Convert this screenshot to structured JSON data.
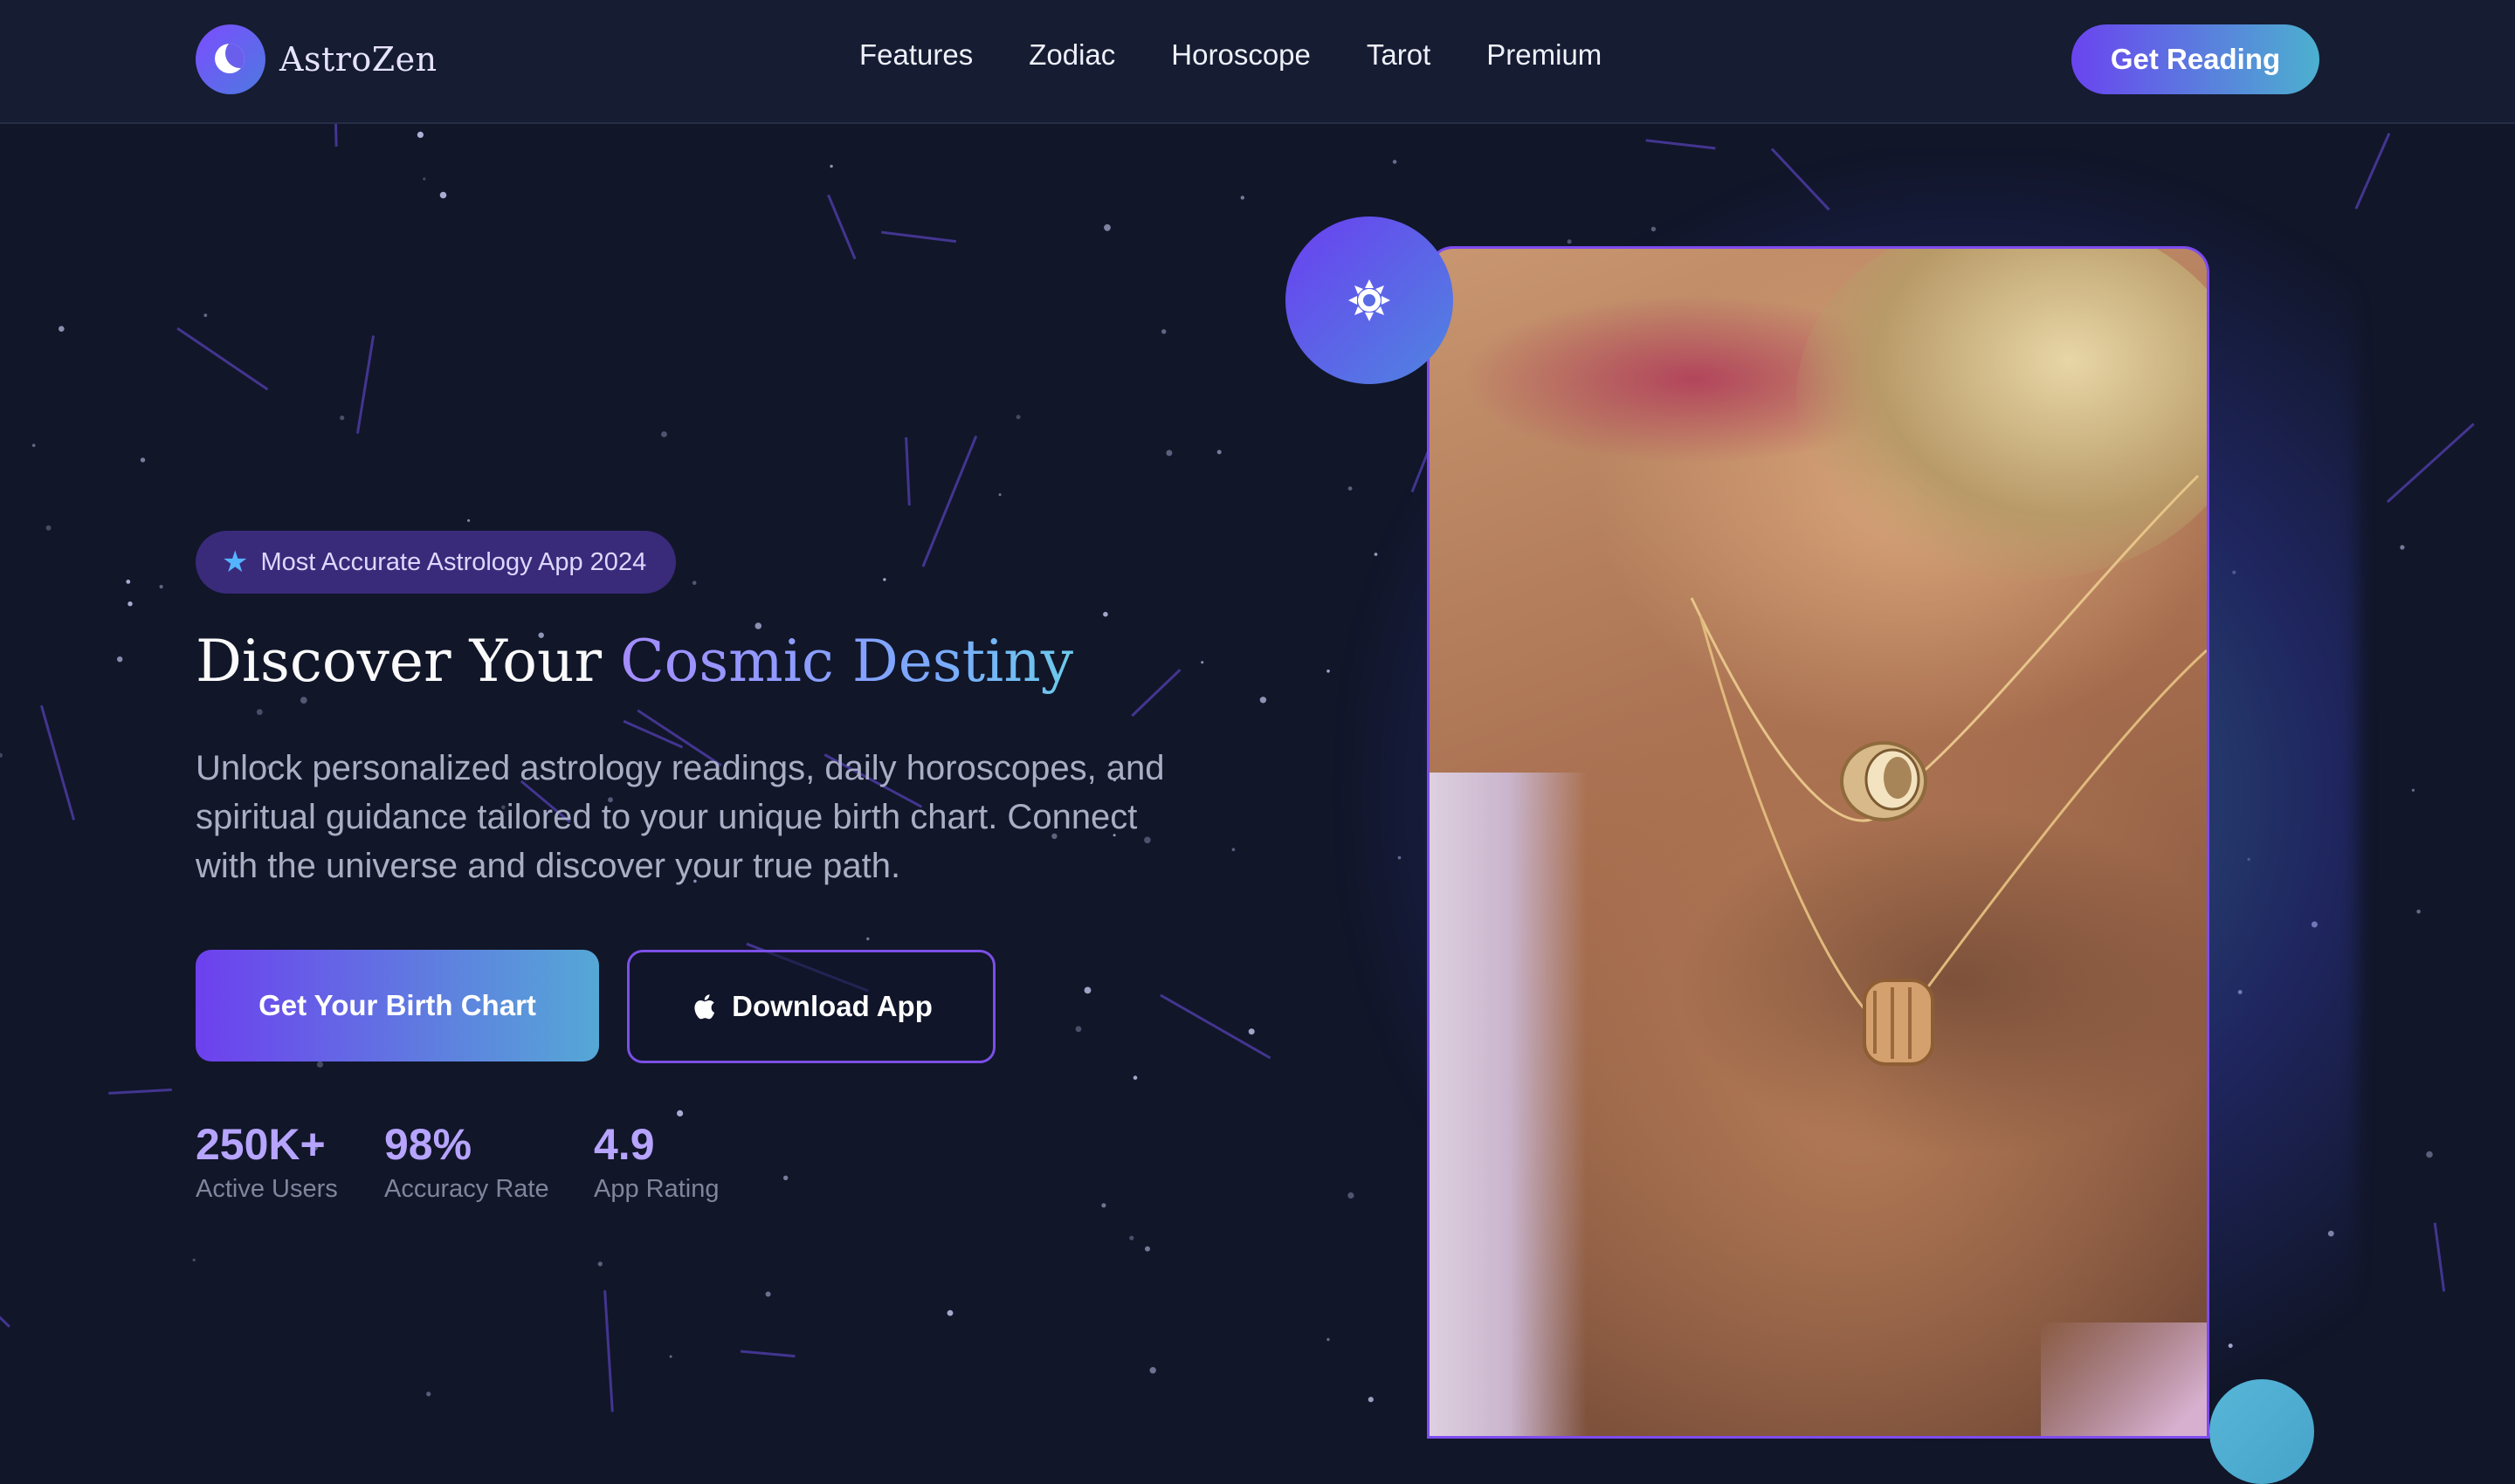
{
  "nav": {
    "brand": "AstroZen",
    "links": [
      "Features",
      "Zodiac",
      "Horoscope",
      "Tarot",
      "Premium"
    ],
    "cta": "Get Reading"
  },
  "hero": {
    "badge": "Most Accurate Astrology App 2024",
    "headline_plain": "Discover Your ",
    "headline_accent": "Cosmic Destiny",
    "lead": "Unlock personalized astrology readings, daily horoscopes, and spiritual guidance tailored to your unique birth chart. Connect with the universe and discover your true path.",
    "primary_cta": "Get Your Birth Chart",
    "secondary_cta": "Download App",
    "stats": [
      {
        "value": "250K+",
        "label": "Active Users"
      },
      {
        "value": "98%",
        "label": "Accuracy Rate"
      },
      {
        "value": "4.9",
        "label": "App Rating"
      }
    ]
  },
  "icons": {
    "logo": "crescent-moon-icon",
    "badge": "star-icon",
    "download": "apple-icon",
    "floating": "sun-icon"
  },
  "colors": {
    "background": "#111629",
    "nav_background": "#161c31",
    "accent_purple": "#6d40ee",
    "accent_cyan": "#55a8d6",
    "stat_number": "#b6a4ff"
  }
}
